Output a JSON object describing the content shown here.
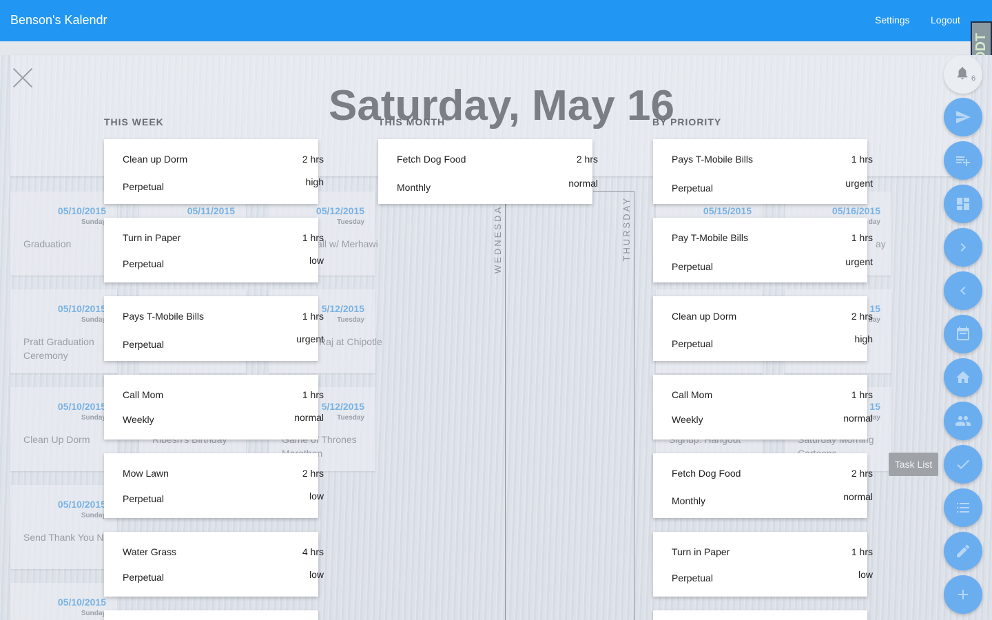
{
  "app": {
    "title": "Benson's Kalendr",
    "settings": "Settings",
    "logout": "Logout",
    "badge": "DDT"
  },
  "day_title": "Saturday, May 16",
  "columns": {
    "week": "THIS WEEK",
    "month": "THIS MONTH",
    "priority": "BY PRIORITY"
  },
  "notifications": {
    "count": "6"
  },
  "tooltip": "Task List",
  "background_cards": [
    {
      "date": "05/10/2015",
      "weekday": "Sunday",
      "event": "Graduation"
    },
    {
      "date": "05/11/2015",
      "weekday": "",
      "event": ""
    },
    {
      "date": "05/12/2015",
      "weekday": "Tuesday",
      "event": "all w/ Merhawi"
    },
    {
      "date": "05/15/2015",
      "weekday": "",
      "event": ""
    },
    {
      "date": "05/16/2015",
      "weekday": "day",
      "event": "ay"
    },
    {
      "date": "05/10/2015",
      "weekday": "Sunday",
      "event": "Pratt Graduation Ceremony"
    },
    {
      "date": "5/12/2015",
      "weekday": "Tuesday",
      "event": "Raj at Chipotle"
    },
    {
      "date": "15",
      "weekday": "day",
      "event": ""
    },
    {
      "date": "05/10/2015",
      "weekday": "Sunday",
      "event": "Clean Up Dorm"
    },
    {
      "date": "",
      "weekday": "",
      "event": "Ribesh's Birthday"
    },
    {
      "date": "5/12/2015",
      "weekday": "Tuesday",
      "event": "Game of Thrones Marathon"
    },
    {
      "date": "",
      "weekday": "",
      "event": "Signup: Hangout"
    },
    {
      "date": "15",
      "weekday": "day",
      "event": "Saturday Morning Cartoons"
    },
    {
      "date": "05/10/2015",
      "weekday": "Sunday",
      "event": "Send Thank You No"
    },
    {
      "date": "05/10/2015",
      "weekday": "Sunday",
      "event": ""
    }
  ],
  "vertical_days": {
    "wed": "WEDNESDA",
    "thu": "THURSDAY"
  },
  "week_tasks": [
    {
      "name": "Clean up Dorm",
      "hours": "2 hrs",
      "recurrence": "Perpetual",
      "priority": "high"
    },
    {
      "name": "Turn in Paper",
      "hours": "1 hrs",
      "recurrence": "Perpetual",
      "priority": "low"
    },
    {
      "name": "Pays T-Mobile Bills",
      "hours": "1 hrs",
      "recurrence": "Perpetual",
      "priority": "urgent"
    },
    {
      "name": "Call Mom",
      "hours": "1 hrs",
      "recurrence": "Weekly",
      "priority": "normal"
    },
    {
      "name": "Mow Lawn",
      "hours": "2 hrs",
      "recurrence": "Perpetual",
      "priority": "low"
    },
    {
      "name": "Water Grass",
      "hours": "4 hrs",
      "recurrence": "Perpetual",
      "priority": "low"
    }
  ],
  "month_tasks": [
    {
      "name": "Fetch Dog Food",
      "hours": "2 hrs",
      "recurrence": "Monthly",
      "priority": "normal"
    }
  ],
  "priority_tasks": [
    {
      "name": "Pays T-Mobile Bills",
      "hours": "1 hrs",
      "recurrence": "Perpetual",
      "priority": "urgent"
    },
    {
      "name": "Pay T-Mobile Bills",
      "hours": "1 hrs",
      "recurrence": "Perpetual",
      "priority": "urgent"
    },
    {
      "name": "Clean up Dorm",
      "hours": "2 hrs",
      "recurrence": "Perpetual",
      "priority": "high"
    },
    {
      "name": "Call Mom",
      "hours": "1 hrs",
      "recurrence": "Weekly",
      "priority": "normal"
    },
    {
      "name": "Fetch Dog Food",
      "hours": "2 hrs",
      "recurrence": "Monthly",
      "priority": "normal"
    },
    {
      "name": "Turn in Paper",
      "hours": "1 hrs",
      "recurrence": "Perpetual",
      "priority": "low"
    }
  ],
  "fab_icons": [
    "send-icon",
    "add-to-list-icon",
    "dashboard-icon",
    "chevron-right-icon",
    "chevron-left-icon",
    "calendar-icon",
    "home-icon",
    "people-icon",
    "check-icon",
    "task-list-icon",
    "edit-icon",
    "add-icon"
  ],
  "colors": {
    "appbar": "#2196f3",
    "fab": "#6aaef0",
    "date_accent": "#78b2e4"
  }
}
